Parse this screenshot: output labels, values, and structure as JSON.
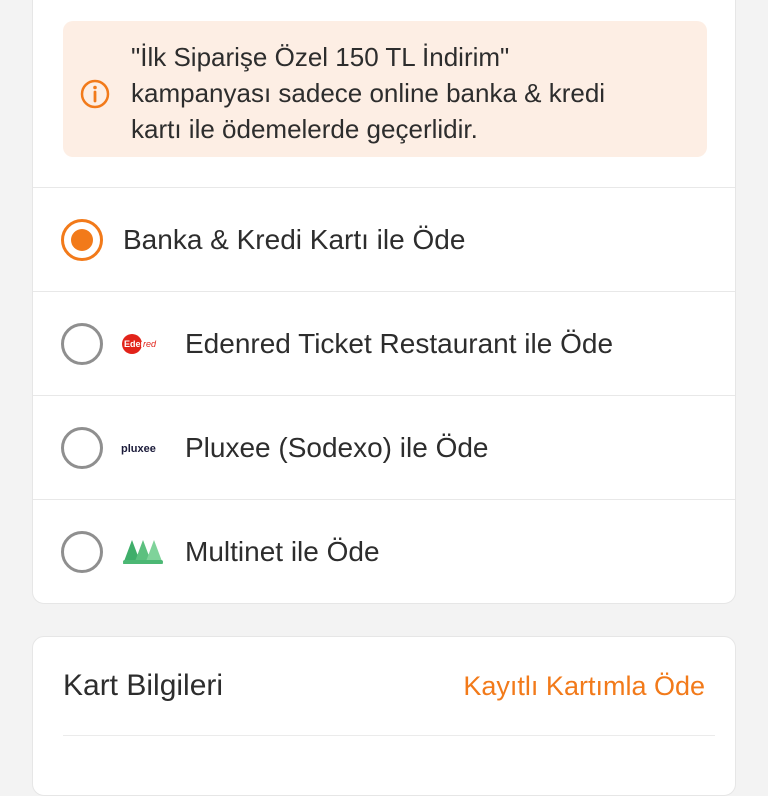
{
  "notice": {
    "icon": "info-circle-icon",
    "text": "\"İlk Siparişe Özel 150 TL İndirim\"\nkampanyası sadece online banka & kredi\nkartı ile ödemelerde geçerlidir."
  },
  "payment_options": [
    {
      "label": "Banka & Kredi Kartı ile Öde",
      "selected": true,
      "logo": ""
    },
    {
      "label": "Edenred Ticket Restaurant ile Öde",
      "selected": false,
      "logo": "edenred-logo",
      "logo_text": "Edenred"
    },
    {
      "label": "Pluxee (Sodexo) ile Öde",
      "selected": false,
      "logo": "pluxee-logo",
      "logo_text": "pluxee"
    },
    {
      "label": "Multinet ile Öde",
      "selected": false,
      "logo": "multinet-logo"
    }
  ],
  "card_section": {
    "title": "Kart Bilgileri",
    "saved_card_link": "Kayıtlı Kartımla Öde"
  },
  "colors": {
    "accent": "#f27a1a",
    "notice_bg": "#fdeee4"
  }
}
